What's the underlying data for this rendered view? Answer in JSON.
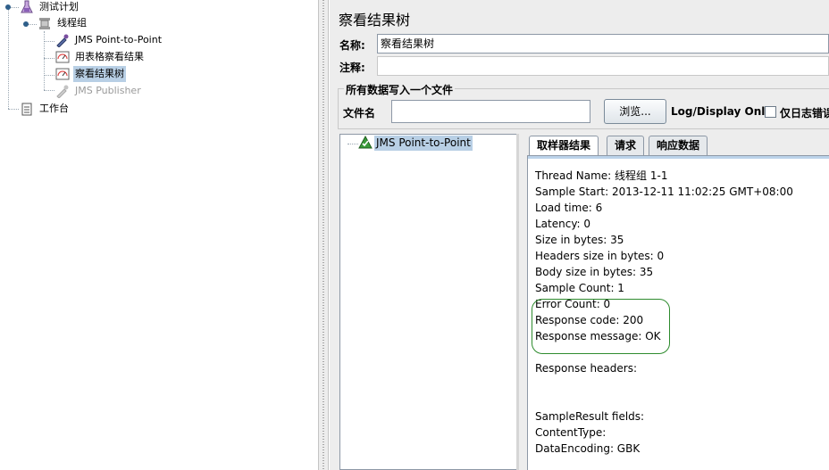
{
  "tree": {
    "items": [
      {
        "label": "测试计划",
        "icon": "flask-icon"
      },
      {
        "label": "线程组",
        "icon": "spool-icon"
      },
      {
        "label": "JMS Point-to-Point",
        "icon": "dropper-icon"
      },
      {
        "label": "用表格察看结果",
        "icon": "meter-icon"
      },
      {
        "label": "察看结果树",
        "icon": "meter-icon"
      },
      {
        "label": "JMS Publisher",
        "icon": "dropper-disabled-icon"
      },
      {
        "label": "工作台",
        "icon": "notepad-icon"
      }
    ]
  },
  "panel": {
    "title": "察看结果树",
    "name_label": "名称:",
    "name_value": "察看结果树",
    "comment_label": "注释:",
    "comment_value": "",
    "file_group_title": "所有数据写入一个文件",
    "filename_label": "文件名",
    "filename_value": "",
    "browse_label": "浏览...",
    "log_display_label": "Log/Display Only:",
    "errors_only_label": "仅日志错误"
  },
  "results": {
    "sample_label": "JMS Point-to-Point",
    "sample_icon": "success-triangle-icon",
    "tabs": [
      "取样器结果",
      "请求",
      "响应数据"
    ],
    "lines": [
      "Thread Name: 线程组 1-1",
      "Sample Start: 2013-12-11 11:02:25 GMT+08:00",
      "Load time: 6",
      "Latency: 0",
      "Size in bytes: 35",
      "Headers size in bytes: 0",
      "Body size in bytes: 35",
      "Sample Count: 1",
      "Error Count: 0",
      "Response code: 200",
      "Response message: OK",
      "",
      "Response headers:",
      "",
      "",
      "SampleResult fields:",
      "ContentType:",
      "DataEncoding: GBK"
    ]
  },
  "colors": {
    "selection": "#b8cfe5",
    "highlight_outline": "#2e8b2e",
    "panel_bg": "#ededed"
  }
}
